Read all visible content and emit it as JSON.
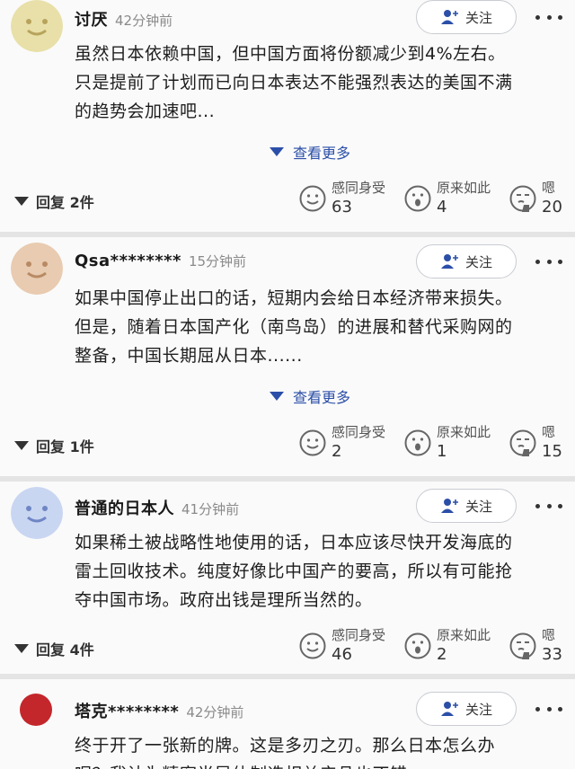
{
  "follow_label": "关注",
  "expand_label": "查看更多",
  "reactions": {
    "empathy": "感同身受",
    "surprise": "原来如此",
    "hmm": "嗯"
  },
  "comments": [
    {
      "username": "讨厌",
      "time": "42分钟前",
      "avatar_color": "#e8e0a8",
      "lines": [
        "虽然日本依赖中国，但中国方面将份额减少到4%左右。",
        "只是提前了计划而已向日本表达不能强烈表达的美国不满",
        "的趋势会加速吧..."
      ],
      "replies": "回复 2件",
      "counts": [
        "63",
        "4",
        "20"
      ]
    },
    {
      "username": "Qsa********",
      "time": "15分钟前",
      "avatar_color": "#e8cbb0",
      "lines": [
        "如果中国停止出口的话，短期内会给日本经济带来损失。",
        "但是，随着日本国产化（南鸟岛）的进展和替代采购网的",
        "整备，中国长期屈从日本......"
      ],
      "replies": "回复 1件",
      "counts": [
        "2",
        "1",
        "15"
      ]
    },
    {
      "username": "普通的日本人",
      "time": "41分钟前",
      "avatar_color": "#c9d6f2",
      "lines": [
        "如果稀土被战略性地使用的话，日本应该尽快开发海底的",
        "雷土回收技术。纯度好像比中国产的要高，所以有可能抢",
        "夺中国市场。政府出钱是理所当然的。"
      ],
      "replies": "回复 4件",
      "counts": [
        "46",
        "2",
        "33"
      ]
    },
    {
      "username": "塔克********",
      "time": "42分钟前",
      "avatar_color": "#c3272b",
      "lines": [
        "终于开了一张新的牌。这是多刃之刃。那么日本怎么办",
        "呢？我认为精密半导体制造相关产品也不错"
      ]
    }
  ]
}
